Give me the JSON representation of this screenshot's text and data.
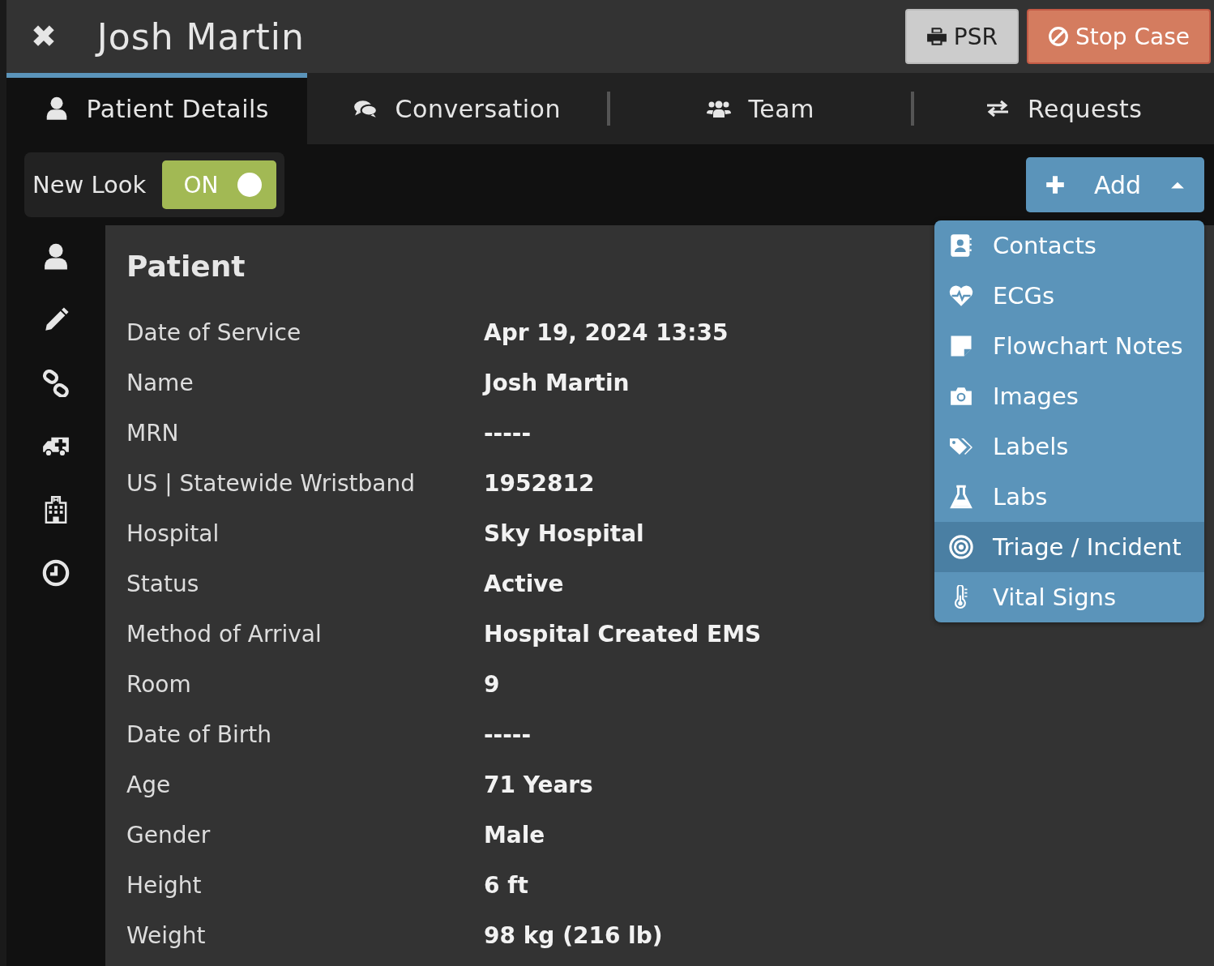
{
  "header": {
    "close_icon": "✖",
    "title": "Josh Martin",
    "buttons": [
      {
        "label": "PSR",
        "kind": "print"
      },
      {
        "label": "Stop Case",
        "kind": "stop"
      }
    ]
  },
  "tabs": [
    {
      "label": "Patient Details",
      "selected": true
    },
    {
      "label": "Conversation",
      "selected": false
    },
    {
      "label": "Team",
      "selected": false
    },
    {
      "label": "Requests",
      "selected": false
    }
  ],
  "new_look": {
    "label": "New Look",
    "switch_text": "ON",
    "on": true
  },
  "add_button": {
    "label": "Add",
    "expanded": true
  },
  "add_menu": [
    {
      "label": "Contacts",
      "selected": false
    },
    {
      "label": "ECGs",
      "selected": false
    },
    {
      "label": "Flowchart Notes",
      "selected": false
    },
    {
      "label": "Images",
      "selected": false
    },
    {
      "label": "Labels",
      "selected": false
    },
    {
      "label": "Labs",
      "selected": false
    },
    {
      "label": "Triage / Incident",
      "selected": true
    },
    {
      "label": "Vital Signs",
      "selected": false
    }
  ],
  "panel": {
    "title": "Patient",
    "rows": [
      {
        "label": "Date of Service",
        "value": "Apr 19, 2024 13:35"
      },
      {
        "label": "Name",
        "value": "Josh Martin"
      },
      {
        "label": "MRN",
        "value": "-----"
      },
      {
        "label": "US | Statewide Wristband",
        "value": "1952812"
      },
      {
        "label": "Hospital",
        "value": "Sky Hospital"
      },
      {
        "label": "Status",
        "value": "Active"
      },
      {
        "label": "Method of Arrival",
        "value": "Hospital Created EMS"
      },
      {
        "label": "Room",
        "value": "9"
      },
      {
        "label": "Date of Birth",
        "value": "-----"
      },
      {
        "label": "Age",
        "value": "71 Years"
      },
      {
        "label": "Gender",
        "value": "Male"
      },
      {
        "label": "Height",
        "value": "6 ft"
      },
      {
        "label": "Weight",
        "value": "98 kg (216 lb)"
      }
    ]
  }
}
